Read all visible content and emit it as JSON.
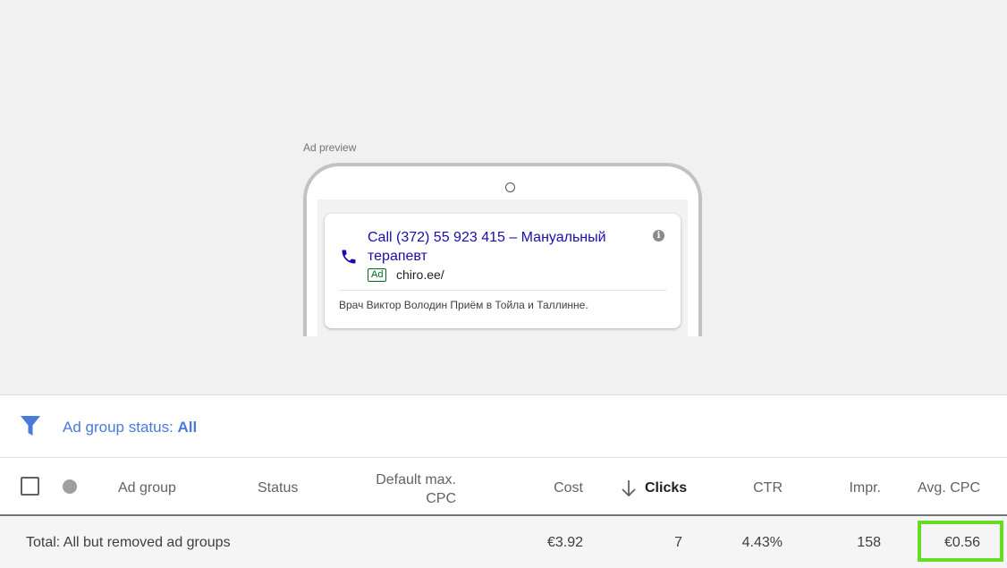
{
  "preview": {
    "label": "Ad preview",
    "ad": {
      "title": "Call (372) 55 923 415 – Мануальный терапевт",
      "badge": "Ad",
      "url": "chiro.ee/",
      "description": "Врач Виктор Володин Приём в Тойла и Таллинне.",
      "info_icon": "i"
    }
  },
  "filter": {
    "label": "Ad group status: ",
    "value": "All",
    "color": "#4a7ad9"
  },
  "table": {
    "headers": {
      "ad_group": "Ad group",
      "status": "Status",
      "default_max_cpc_line1": "Default max.",
      "default_max_cpc_line2": "CPC",
      "cost": "Cost",
      "clicks": "Clicks",
      "ctr": "CTR",
      "impr": "Impr.",
      "avg_cpc": "Avg. CPC"
    },
    "total": {
      "label": "Total: All but removed ad groups",
      "cost": "€3.92",
      "clicks": "7",
      "ctr": "4.43%",
      "impr": "158",
      "avg_cpc": "€0.56"
    },
    "highlight_color": "#66dd22"
  }
}
